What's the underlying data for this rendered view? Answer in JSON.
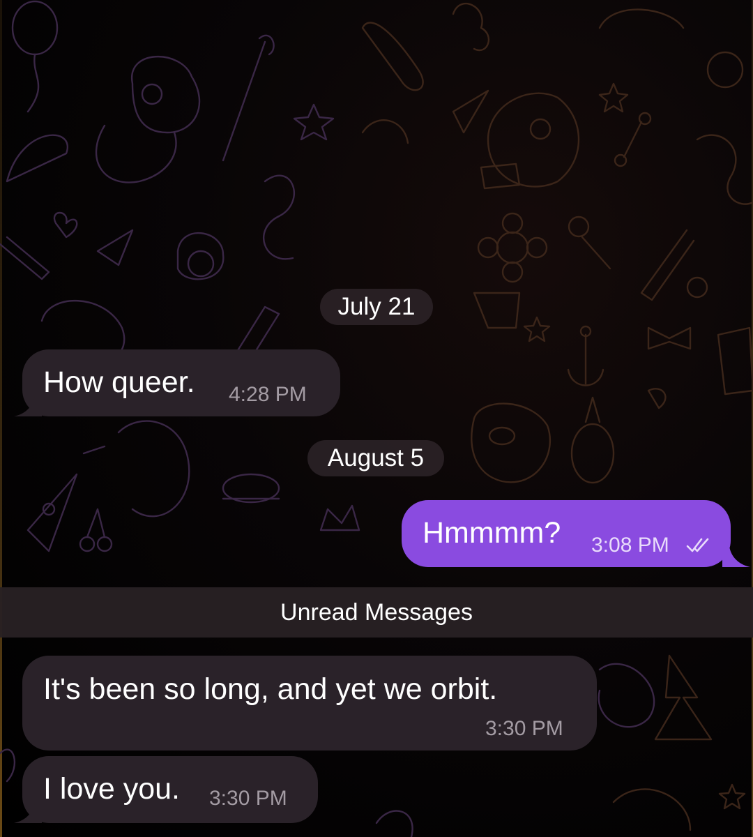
{
  "chat": {
    "date_chips": [
      {
        "label": "July 21"
      },
      {
        "label": "August 5"
      }
    ],
    "messages": [
      {
        "direction": "incoming",
        "text": "How queer.",
        "time": "4:28 PM"
      },
      {
        "direction": "outgoing",
        "text": "Hmmmm?",
        "time": "3:08 PM",
        "status": "read-double-check-icon"
      },
      {
        "direction": "incoming",
        "text": "It's been so long, and yet we orbit.",
        "time": "3:30 PM"
      },
      {
        "direction": "incoming",
        "text": "I love you.",
        "time": "3:30 PM"
      }
    ],
    "unread_separator": "Unread Messages",
    "colors": {
      "incoming_bubble": "#2a2229",
      "outgoing_bubble": "#8a4be0",
      "background": "#000000",
      "timestamp": "#a49ca4"
    }
  }
}
